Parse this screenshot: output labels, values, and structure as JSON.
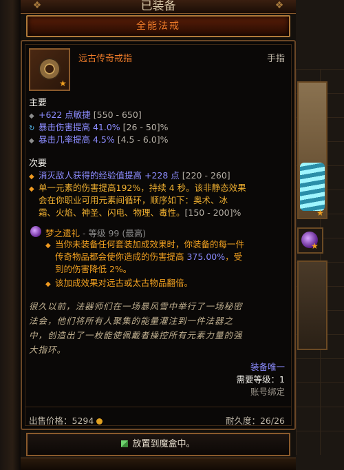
{
  "header": {
    "equipped_label": "已装备"
  },
  "item": {
    "name": "全能法戒",
    "type_name": "远古传奇戒指",
    "slot_type": "手指"
  },
  "primary": {
    "heading": "主要",
    "stats": [
      {
        "text": "+622 点敏捷",
        "range": " [550 - 650]",
        "bullet": "grey"
      },
      {
        "text": "暴击伤害提高 41.0%",
        "range": " [26 - 50]%",
        "bullet": "cyan"
      },
      {
        "text": "暴击几率提高 4.5%",
        "range": " [4.5 - 6.0]%",
        "bullet": "grey"
      }
    ]
  },
  "secondary": {
    "heading": "次要",
    "stat1": {
      "text": "消灭敌人获得的经验值提高 +228 点",
      "range": " [220 - 260]"
    },
    "stat2": {
      "line1": "单一元素的伤害提高192%，持续 4 秒。该非静态效果",
      "line2": "会在你职业可用元素间循环，顺序如下：奥术、冰",
      "line3": "霜、火焰、神圣、闪电、物理、毒性。",
      "range": "[150 - 200]%"
    }
  },
  "legacy": {
    "title": "梦之遗礼",
    "rank": " - 等级 99 (最高)",
    "line1": "当你未装备任何套装加成效果时，你装备的每一件",
    "line2_pre": "传奇物品都会使你造成的伤害提高 ",
    "line2_pct": "375.00%",
    "line2_post": "，受",
    "line3": "到的伤害降低 2%。",
    "line4": "该加成效果对远古或太古物品翻倍。"
  },
  "lore": {
    "line1": "很久以前，法器师们在一场暴风雪中举行了一场秘密",
    "line2": "法会，他们将所有人聚集的能量灌注到一件法器之",
    "line3": "中，创造出了一枚能使佩戴者操控所有元素力量的强",
    "line4": "大指环。"
  },
  "requirements": {
    "unique": "装备唯一",
    "level_req": "需要等级：1",
    "account_bound": "账号绑定"
  },
  "footer": {
    "sell_label": "出售价格：",
    "sell_value": "5294",
    "durability": "耐久度：26/26"
  },
  "cube_button": {
    "label": "放置到魔盒中。"
  },
  "colors": {
    "item_name": "#f07d2a",
    "magic_stat": "#8c8cff",
    "legendary_affix": "#f0b030"
  }
}
